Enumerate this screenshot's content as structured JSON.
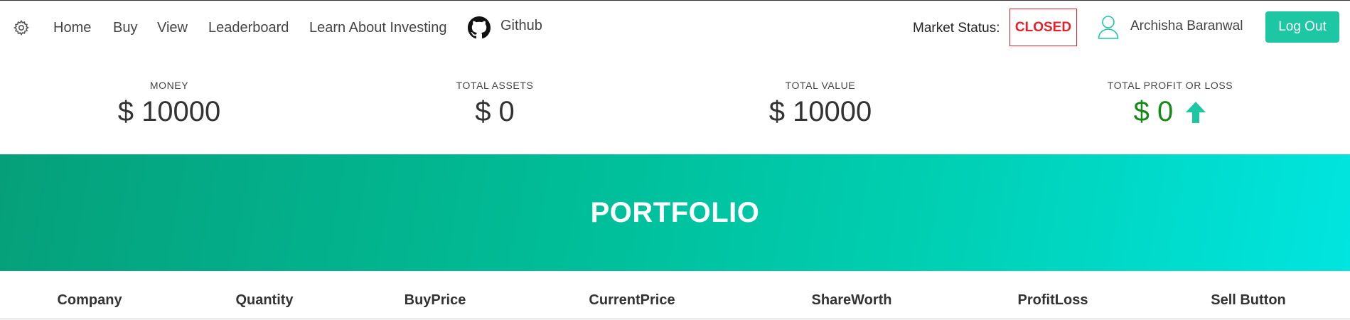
{
  "nav": {
    "logo_icon": "gear-icon",
    "links": [
      "Home",
      "Buy",
      "View",
      "Leaderboard",
      "Learn About Investing"
    ],
    "github_icon": "github-icon",
    "github_label": "Github",
    "market_status_label": "Market Status:",
    "market_status_value": "CLOSED",
    "user_icon": "user-icon",
    "user_name": "Archisha Baranwal",
    "logout_label": "Log Out"
  },
  "stats": [
    {
      "label": "MONEY",
      "value": "$ 10000"
    },
    {
      "label": "TOTAL ASSETS",
      "value": "$ 0"
    },
    {
      "label": "TOTAL VALUE",
      "value": "$ 10000"
    },
    {
      "label": "TOTAL PROFIT OR LOSS",
      "value": "$ 0",
      "trend_icon": "arrow-up-icon"
    }
  ],
  "banner": {
    "title": "PORTFOLIO"
  },
  "table": {
    "columns": [
      "Company",
      "Quantity",
      "BuyPrice",
      "CurrentPrice",
      "ShareWorth",
      "ProfitLoss",
      "Sell Button"
    ]
  },
  "colors": {
    "accent": "#1dc7a4",
    "market_closed": "#e8202a",
    "profit": "#168a16",
    "banner_start": "#05a07a",
    "banner_end": "#00e5e0"
  }
}
